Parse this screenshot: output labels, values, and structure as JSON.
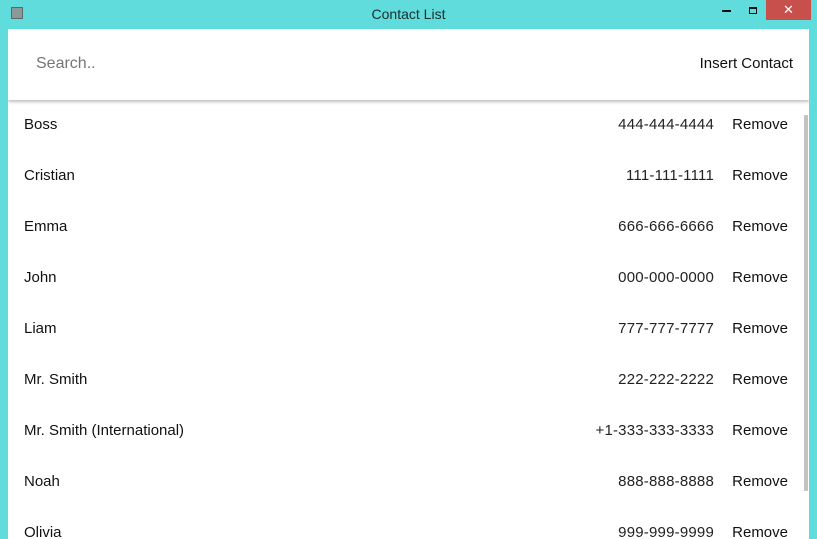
{
  "window": {
    "title": "Contact List"
  },
  "header": {
    "search_placeholder": "Search..",
    "insert_label": "Insert Contact"
  },
  "contacts": [
    {
      "name": "Boss",
      "phone": "444-444-4444",
      "action": "Remove"
    },
    {
      "name": "Cristian",
      "phone": "111-111-1111",
      "action": "Remove"
    },
    {
      "name": "Emma",
      "phone": "666-666-6666",
      "action": "Remove"
    },
    {
      "name": "John",
      "phone": "000-000-0000",
      "action": "Remove"
    },
    {
      "name": "Liam",
      "phone": "777-777-7777",
      "action": "Remove"
    },
    {
      "name": "Mr. Smith",
      "phone": "222-222-2222",
      "action": "Remove"
    },
    {
      "name": "Mr. Smith (International)",
      "phone": "+1-333-333-3333",
      "action": "Remove"
    },
    {
      "name": "Noah",
      "phone": "888-888-8888",
      "action": "Remove"
    },
    {
      "name": "Olivia",
      "phone": "999-999-9999",
      "action": "Remove"
    }
  ],
  "colors": {
    "window_frame": "#61dcdc",
    "close_button": "#c7504c",
    "scrollbar_thumb": "#c2c2c2"
  }
}
